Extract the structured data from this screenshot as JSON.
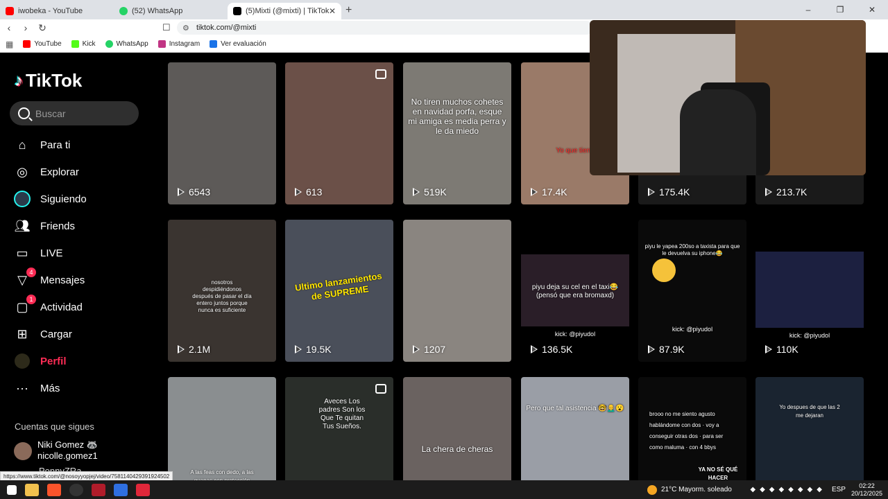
{
  "browser": {
    "tabs": [
      {
        "title": "iwobeka - YouTube",
        "favicon_color": "#ff0000"
      },
      {
        "title": "(52) WhatsApp",
        "favicon_color": "#25d366"
      },
      {
        "title": "(5)Mixti (@mixti) | TikTok",
        "favicon_color": "#000000"
      }
    ],
    "new_tab": "+",
    "url": "tiktok.com/@mixti",
    "bookmarks": [
      {
        "label": "YouTube",
        "color": "#ff0000"
      },
      {
        "label": "Kick",
        "color": "#53fc18"
      },
      {
        "label": "WhatsApp",
        "color": "#25d366"
      },
      {
        "label": "Instagram",
        "color": "#c13584"
      },
      {
        "label": "Ver evaluación",
        "color": "#1a73e8"
      }
    ],
    "window_controls": [
      "–",
      "❐",
      "✕"
    ],
    "status_url": "https://www.tiktok.com/@nosoyyopjej/video/7581140429391924502"
  },
  "sidebar": {
    "logo": "TikTok",
    "search_placeholder": "Buscar",
    "nav": [
      {
        "label": "Para ti",
        "icon": "home-icon"
      },
      {
        "label": "Explorar",
        "icon": "compass-icon"
      },
      {
        "label": "Siguiendo",
        "icon": "following-avatar-icon"
      },
      {
        "label": "Friends",
        "icon": "friends-icon"
      },
      {
        "label": "LIVE",
        "icon": "live-tv-icon"
      },
      {
        "label": "Mensajes",
        "icon": "send-icon",
        "badge": "4"
      },
      {
        "label": "Actividad",
        "icon": "inbox-icon",
        "badge": "1"
      },
      {
        "label": "Cargar",
        "icon": "upload-icon"
      },
      {
        "label": "Perfil",
        "icon": "profile-avatar-icon"
      },
      {
        "label": "Más",
        "icon": "more-icon"
      }
    ],
    "following_heading": "Cuentas que sigues",
    "accounts": [
      {
        "name": "Niki Gomez 🦝",
        "handle": "nicolle.gomez1"
      },
      {
        "name": "PonnyZRa"
      }
    ]
  },
  "videos": [
    {
      "views": "6543",
      "bg": "#5d5a58",
      "caption": ""
    },
    {
      "views": "613",
      "bg": "#6b5048",
      "caption": "",
      "photo": true
    },
    {
      "views": "519K",
      "bg": "#7d7a74",
      "caption": "No tiren muchos cohetes en navidad porfa, esque mi amiga es media perra y le da miedo"
    },
    {
      "views": "17.4K",
      "bg": "#9a7a68",
      "caption": "Yo que tiene"
    },
    {
      "views": "175.4K",
      "bg": "#1a1a1a",
      "caption": ""
    },
    {
      "views": "213.7K",
      "bg": "#1a1a1a",
      "caption": ""
    },
    {
      "views": "2.1M",
      "bg": "#3a3430",
      "caption": "nosotros despidiéndonos después de pasar el día entero juntos porque nunca es suficiente"
    },
    {
      "views": "19.5K",
      "bg": "#4a4f5a",
      "caption": "Ultimo lanzamientos de SUPREME"
    },
    {
      "views": "1207",
      "bg": "#8a8580",
      "caption": ""
    },
    {
      "views": "136.5K",
      "bg": "#2a1e28",
      "caption": "piyu deja su cel en el taxi😂 (pensó que era bromaxd)",
      "subcap": "kick: @piyudol"
    },
    {
      "views": "87.9K",
      "bg": "#0a0a0a",
      "caption": "piyu le yapea 200so a taxista para que le devuelva su iphone😂",
      "subcap": "kick: @piyudol"
    },
    {
      "views": "110K",
      "bg": "#1c2040",
      "caption": "",
      "subcap": "kick: @piyudol"
    },
    {
      "views": "",
      "bg": "#8a8e90",
      "caption": "A las feas con dedo, a las guapas con protección"
    },
    {
      "views": "",
      "bg": "#2a2e2a",
      "caption": "Aveces Los padres Son los Que Te quitan Tus Sueños.",
      "photo": true
    },
    {
      "views": "",
      "bg": "#6a6260",
      "caption": "La chera de cheras"
    },
    {
      "views": "",
      "bg": "#9a9ea6",
      "caption": "Pero que tal asistencia 🤓👨‍🦲😮"
    },
    {
      "views": "",
      "bg": "#0a0a0a",
      "caption": "brooo no me siento agusto hablándome con dos · voy a conseguir otras dos · para ser como maluma · con 4 bbys",
      "subcap": "YA NO SÉ QUÉ HACER"
    },
    {
      "views": "",
      "bg": "#1a2430",
      "caption": "Yo despues de que las 2 me dejaran"
    }
  ],
  "taskbar": {
    "weather": "21°C  Mayorm. soleado",
    "lang": "ESP",
    "time": "02:22",
    "date": "20/12/2025"
  }
}
